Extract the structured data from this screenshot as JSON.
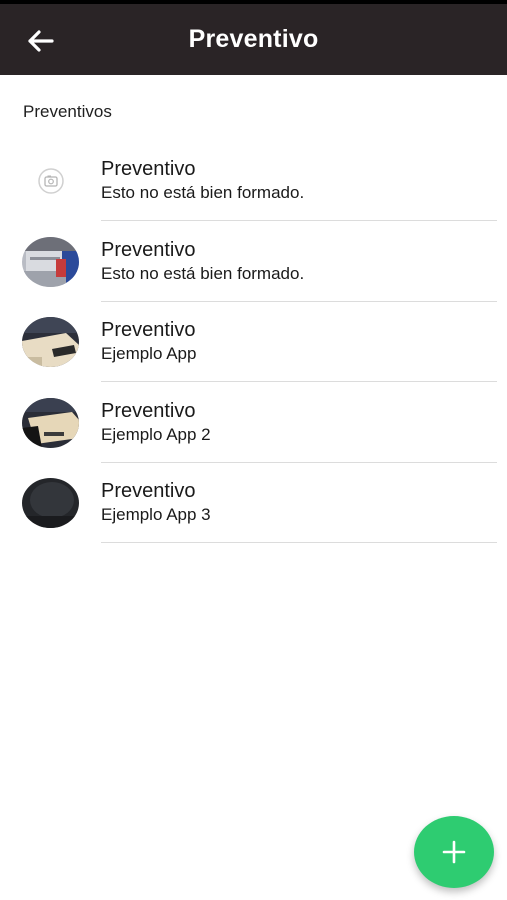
{
  "appbar": {
    "title": "Preventivo",
    "back_icon": "arrow-left-icon"
  },
  "section": {
    "title": "Preventivos"
  },
  "items": [
    {
      "title": "Preventivo",
      "subtitle": "Esto no está bien formado.",
      "avatar": "broken-image-icon"
    },
    {
      "title": "Preventivo",
      "subtitle": "Esto no está bien formado.",
      "avatar": "photo-thumbnail"
    },
    {
      "title": "Preventivo",
      "subtitle": "Ejemplo App",
      "avatar": "photo-thumbnail"
    },
    {
      "title": "Preventivo",
      "subtitle": "Ejemplo App 2",
      "avatar": "photo-thumbnail"
    },
    {
      "title": "Preventivo",
      "subtitle": "Ejemplo App 3",
      "avatar": "photo-thumbnail"
    }
  ],
  "fab": {
    "icon": "plus-icon",
    "color": "#2ecc71"
  },
  "colors": {
    "appbar": "#2a2426",
    "divider": "#dcdcdc"
  }
}
